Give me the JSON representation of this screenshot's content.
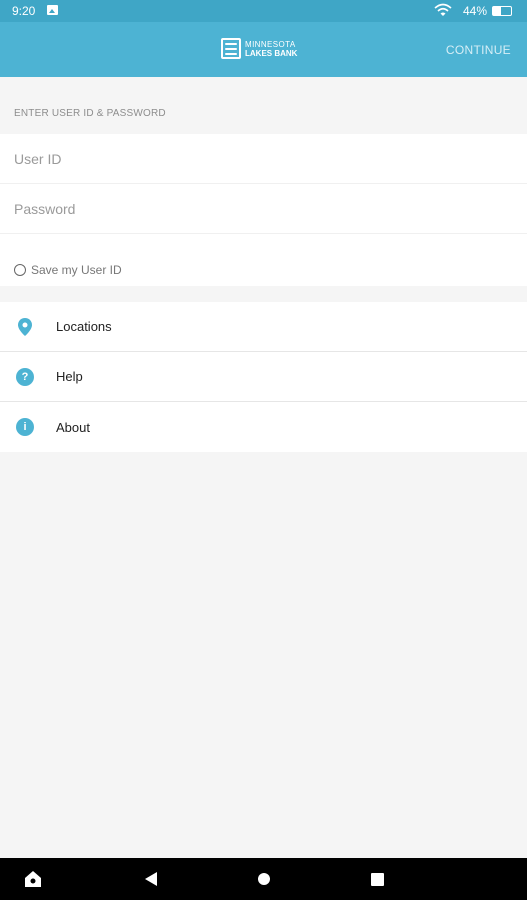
{
  "status_bar": {
    "time": "9:20",
    "battery_percent": "44%",
    "battery_level": 0.44,
    "icons": [
      "image-notification-icon",
      "wifi-icon",
      "battery-icon"
    ]
  },
  "app_bar": {
    "logo_line1": "MINNESOTA",
    "logo_line2": "LAKES BANK",
    "continue_label": "CONTINUE"
  },
  "login": {
    "section_label": "ENTER USER ID & PASSWORD",
    "user_id_placeholder": "User ID",
    "password_placeholder": "Password",
    "save_user_id_label": "Save my User ID"
  },
  "menu": {
    "items": [
      {
        "label": "Locations",
        "icon": "location-pin-icon"
      },
      {
        "label": "Help",
        "icon": "help-icon"
      },
      {
        "label": "About",
        "icon": "info-icon"
      }
    ]
  },
  "colors": {
    "status_bar": "#3fa6c6",
    "app_bar": "#4db3d3",
    "accent": "#4db3d3",
    "background": "#f5f5f5"
  },
  "nav_bar": {
    "buttons": [
      "home-app-icon",
      "back-icon",
      "home-icon",
      "recents-icon"
    ]
  }
}
